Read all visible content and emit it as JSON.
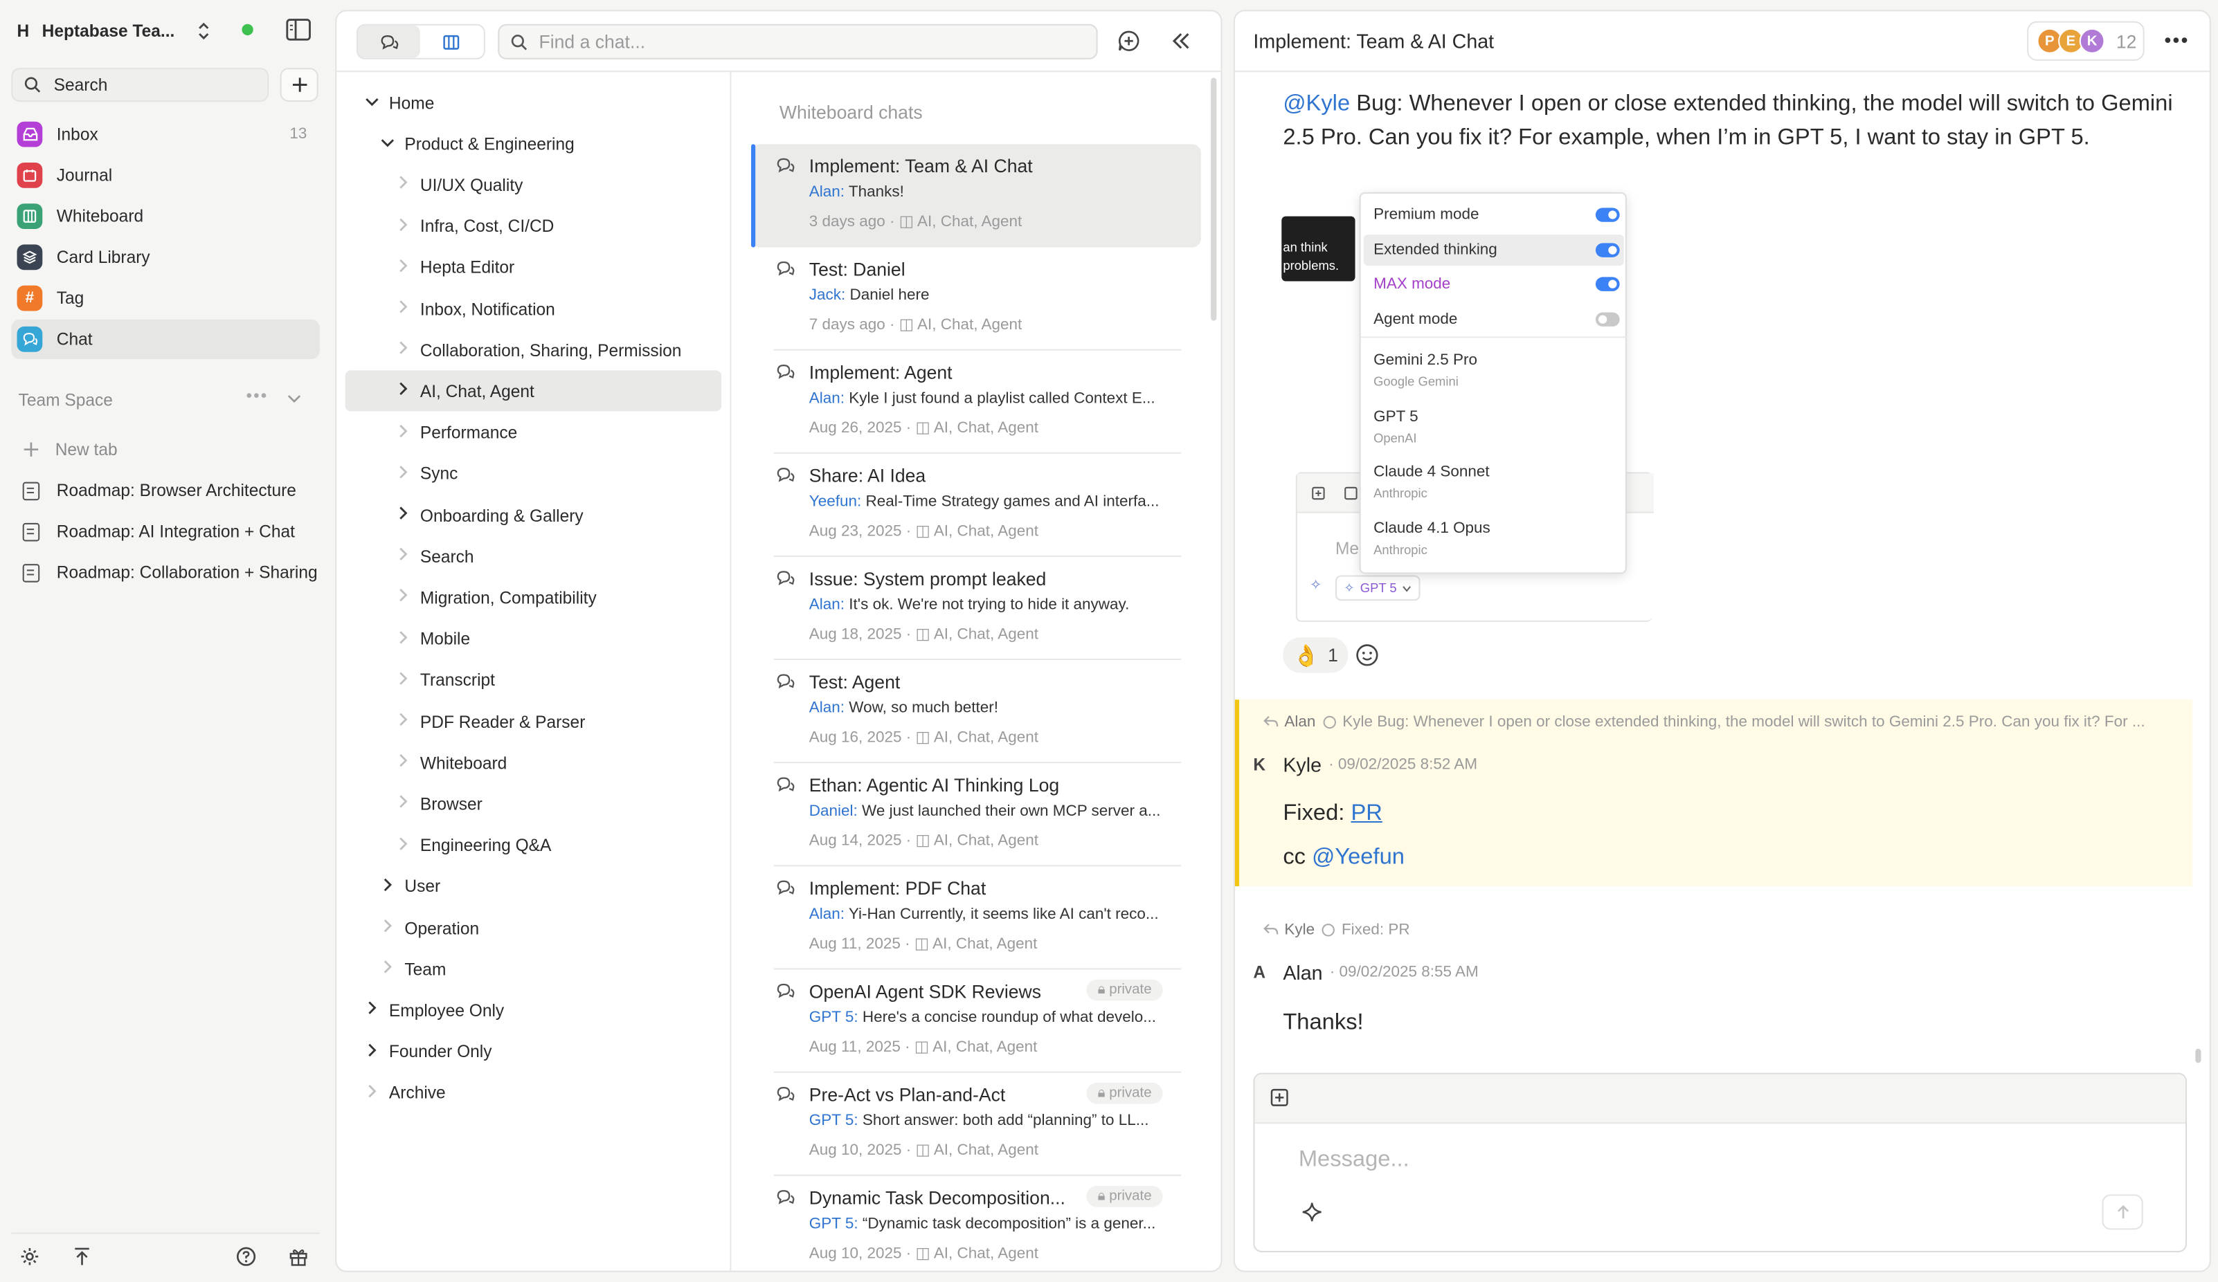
{
  "workspace": {
    "initial": "H",
    "name": "Heptabase Tea..."
  },
  "sidebar": {
    "search_label": "Search",
    "items": [
      {
        "label": "Inbox",
        "count": "13",
        "color": "#b43fd6",
        "icon": "inbox-icon"
      },
      {
        "label": "Journal",
        "color": "#e0424c",
        "icon": "journal-icon"
      },
      {
        "label": "Whiteboard",
        "color": "#3aa275",
        "icon": "whiteboard-icon"
      },
      {
        "label": "Card Library",
        "color": "#3a4453",
        "icon": "card-library-icon"
      },
      {
        "label": "Tag",
        "color": "#f07a2a",
        "icon": "tag-icon"
      },
      {
        "label": "Chat",
        "color": "#36a6d6",
        "icon": "chat-icon"
      }
    ],
    "team_space_label": "Team Space",
    "new_tab_label": "New tab",
    "tabs": [
      "Roadmap: Browser Architecture",
      "Roadmap: AI Integration + Chat",
      "Roadmap: Collaboration + Sharing"
    ]
  },
  "chat_list": {
    "search_placeholder": "Find a chat...",
    "section_title": "Whiteboard chats",
    "tree": [
      {
        "label": "Home",
        "depth": 0,
        "expanded": true
      },
      {
        "label": "Product & Engineering",
        "depth": 1,
        "expanded": true
      },
      {
        "label": "UI/UX Quality",
        "depth": 2
      },
      {
        "label": "Infra, Cost, CI/CD",
        "depth": 2
      },
      {
        "label": "Hepta Editor",
        "depth": 2
      },
      {
        "label": "Inbox, Notification",
        "depth": 2
      },
      {
        "label": "Collaboration, Sharing, Permission",
        "depth": 2
      },
      {
        "label": "AI, Chat, Agent",
        "depth": 2,
        "selected": true,
        "children": true
      },
      {
        "label": "Performance",
        "depth": 2
      },
      {
        "label": "Sync",
        "depth": 2
      },
      {
        "label": "Onboarding & Gallery",
        "depth": 2,
        "children": true
      },
      {
        "label": "Search",
        "depth": 2
      },
      {
        "label": "Migration, Compatibility",
        "depth": 2
      },
      {
        "label": "Mobile",
        "depth": 2
      },
      {
        "label": "Transcript",
        "depth": 2
      },
      {
        "label": "PDF Reader & Parser",
        "depth": 2
      },
      {
        "label": "Whiteboard",
        "depth": 2
      },
      {
        "label": "Browser",
        "depth": 2
      },
      {
        "label": "Engineering Q&A",
        "depth": 2
      },
      {
        "label": "User",
        "depth": 1,
        "children": true
      },
      {
        "label": "Operation",
        "depth": 1
      },
      {
        "label": "Team",
        "depth": 1
      },
      {
        "label": "Employee Only",
        "depth": 0,
        "children": true
      },
      {
        "label": "Founder Only",
        "depth": 0,
        "children": true
      },
      {
        "label": "Archive",
        "depth": 0
      }
    ],
    "chats": [
      {
        "title": "Implement: Team & AI Chat",
        "author": "Alan:",
        "preview": "Thanks!",
        "date": "3 days ago",
        "tags": "AI, Chat, Agent",
        "selected": true
      },
      {
        "title": "Test: Daniel",
        "author": "Jack:",
        "preview": "Daniel here",
        "date": "7 days ago",
        "tags": "AI, Chat, Agent"
      },
      {
        "title": "Implement: Agent",
        "author": "Alan:",
        "preview": "Kyle I just found a playlist called Context E...",
        "date": "Aug 26, 2025",
        "tags": "AI, Chat, Agent"
      },
      {
        "title": "Share: AI Idea",
        "author": "Yeefun:",
        "preview": "Real-Time Strategy games and AI interfa...",
        "date": "Aug 23, 2025",
        "tags": "AI, Chat, Agent"
      },
      {
        "title": "Issue: System prompt leaked",
        "author": "Alan:",
        "preview": "It's ok. We're not trying to hide it anyway.",
        "date": "Aug 18, 2025",
        "tags": "AI, Chat, Agent"
      },
      {
        "title": "Test: Agent",
        "author": "Alan:",
        "preview": "Wow, so much better!",
        "date": "Aug 16, 2025",
        "tags": "AI, Chat, Agent"
      },
      {
        "title": "Ethan: Agentic AI Thinking Log",
        "author": "Daniel:",
        "preview": "We just launched their own MCP server a...",
        "date": "Aug 14, 2025",
        "tags": "AI, Chat, Agent"
      },
      {
        "title": "Implement: PDF Chat",
        "author": "Alan:",
        "preview": "Yi-Han Currently, it seems like AI can't reco...",
        "date": "Aug 11, 2025",
        "tags": "AI, Chat, Agent"
      },
      {
        "title": "OpenAI Agent SDK Reviews",
        "author": "GPT 5:",
        "preview": "Here's a concise roundup of what develo...",
        "date": "Aug 11, 2025",
        "tags": "AI, Chat, Agent",
        "private": "private"
      },
      {
        "title": "Pre-Act vs Plan-and-Act",
        "author": "GPT 5:",
        "preview": "Short answer: both add “planning” to LL...",
        "date": "Aug 10, 2025",
        "tags": "AI, Chat, Agent",
        "private": "private"
      },
      {
        "title": "Dynamic Task Decomposition...",
        "author": "GPT 5:",
        "preview": "“Dynamic task decomposition” is a gener...",
        "date": "Aug 10, 2025",
        "tags": "AI, Chat, Agent",
        "private": "private"
      }
    ]
  },
  "conversation": {
    "title": "Implement: Team & AI Chat",
    "participants": [
      "P",
      "E",
      "K"
    ],
    "participant_count": "12",
    "first_message": {
      "mention": "@Kyle",
      "text": " Bug: Whenever I open or close extended thinking, the model will switch to Gemini 2.5 Pro. Can you fix it? For example, when I’m in GPT 5, I want to stay in GPT 5."
    },
    "screenshot": {
      "tooltip_line1": "an think",
      "tooltip_line2": "problems.",
      "menu_toggles": [
        {
          "label": "Premium mode",
          "on": true
        },
        {
          "label": "Extended thinking",
          "on": true
        },
        {
          "label": "MAX mode",
          "on": true,
          "accent": "#a43fc9"
        },
        {
          "label": "Agent mode",
          "on": false
        }
      ],
      "menu_models": [
        {
          "name": "Gemini 2.5 Pro",
          "provider": "Google Gemini"
        },
        {
          "name": "GPT 5",
          "provider": "OpenAI"
        },
        {
          "name": "Claude 4 Sonnet",
          "provider": "Anthropic"
        },
        {
          "name": "Claude 4.1 Opus",
          "provider": "Anthropic"
        }
      ],
      "input_partial": "Me",
      "model_chip": "GPT 5"
    },
    "reaction": {
      "emoji": "👌",
      "count": "1"
    },
    "reply1": {
      "quote_author": "Alan",
      "quote_text": "Kyle Bug: Whenever I open or close extended thinking, the model will switch to Gemini 2.5 Pro. Can you fix it? For ...",
      "avatar": "K",
      "author": "Kyle",
      "timestamp": "· 09/02/2025 8:52 AM",
      "line1_text": "Fixed: ",
      "line1_link": "PR",
      "line2_text": "cc ",
      "line2_mention": "@Yeefun"
    },
    "reply2": {
      "quote_author": "Kyle",
      "quote_text": "Fixed: PR",
      "avatar": "A",
      "author": "Alan",
      "timestamp": "· 09/02/2025 8:55 AM",
      "text": "Thanks!"
    },
    "composer": {
      "placeholder": "Message..."
    }
  },
  "colors": {
    "accent": "#3b82f6",
    "highlight": "#fffbe6",
    "highlight_bar": "#f2c511"
  }
}
